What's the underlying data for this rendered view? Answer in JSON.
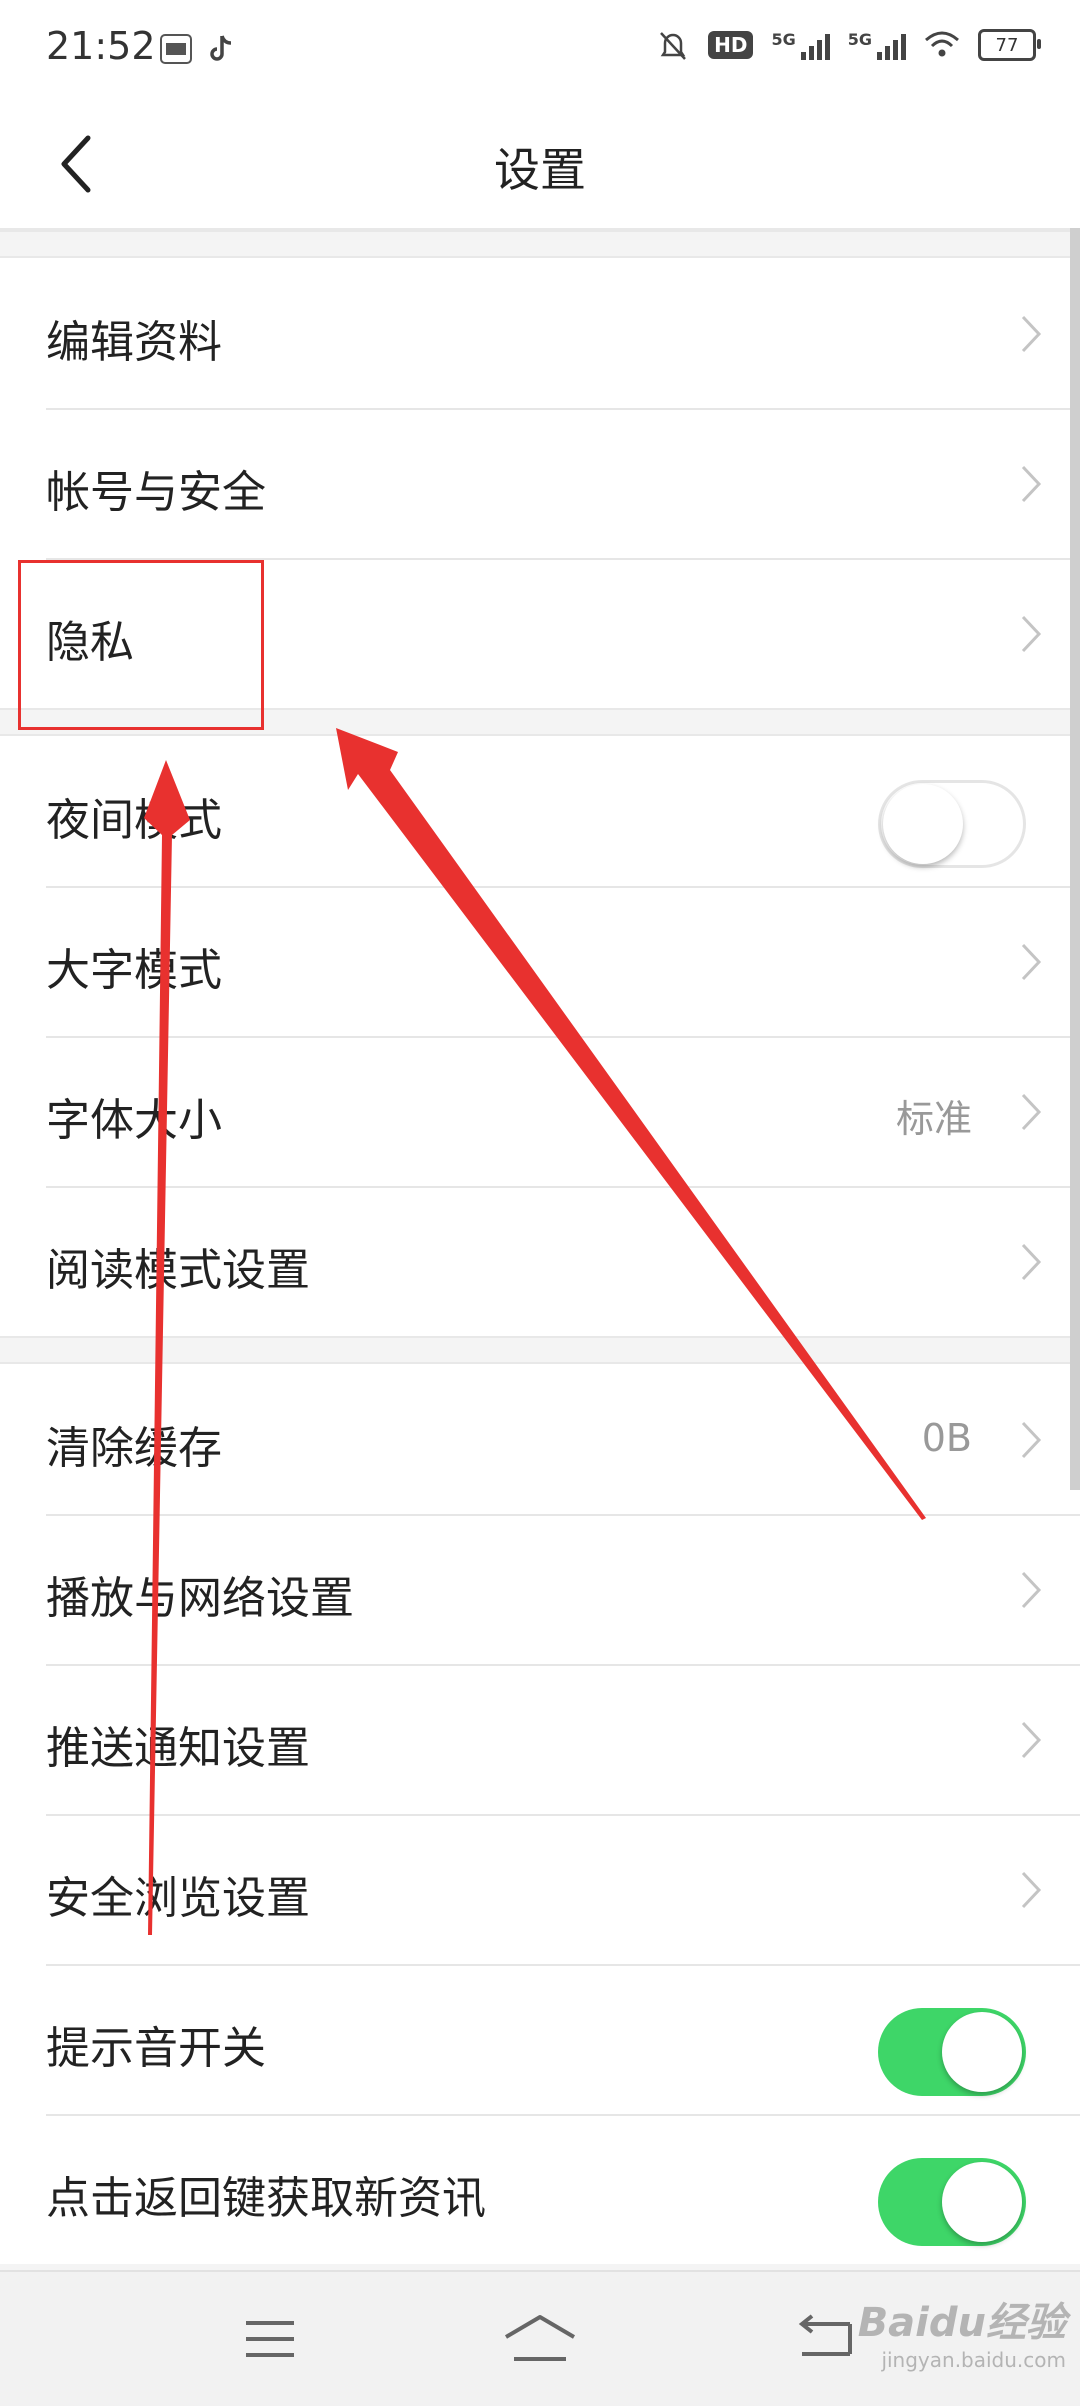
{
  "status_bar": {
    "time": "21:52",
    "hd_label": "HD",
    "sim1_label": "5G",
    "sim2_label": "5G",
    "battery": "77"
  },
  "header": {
    "title": "设置"
  },
  "groups": [
    {
      "items": [
        {
          "label": "编辑资料",
          "control": "chevron"
        },
        {
          "label": "帐号与安全",
          "control": "chevron"
        },
        {
          "label": "隐私",
          "control": "chevron"
        }
      ]
    },
    {
      "items": [
        {
          "label": "夜间模式",
          "control": "toggle",
          "state": "off"
        },
        {
          "label": "大字模式",
          "control": "chevron"
        },
        {
          "label": "字体大小",
          "control": "chevron",
          "value": "标准"
        },
        {
          "label": "阅读模式设置",
          "control": "chevron"
        }
      ]
    },
    {
      "items": [
        {
          "label": "清除缓存",
          "control": "chevron",
          "value": "0B"
        },
        {
          "label": "播放与网络设置",
          "control": "chevron"
        },
        {
          "label": "推送通知设置",
          "control": "chevron"
        },
        {
          "label": "安全浏览设置",
          "control": "chevron"
        },
        {
          "label": "提示音开关",
          "control": "toggle",
          "state": "on"
        },
        {
          "label": "点击返回键获取新资讯",
          "control": "toggle",
          "state": "on"
        }
      ]
    }
  ],
  "bottom_nav": {
    "icons": [
      "menu-icon",
      "home-icon",
      "back-nav-icon"
    ]
  },
  "watermark": {
    "brand": "Baidu经验",
    "url": "jingyan.baidu.com"
  },
  "colors": {
    "toggle_on": "#3ed668",
    "annotation_red": "#e8312f",
    "value_gray": "#999999"
  }
}
